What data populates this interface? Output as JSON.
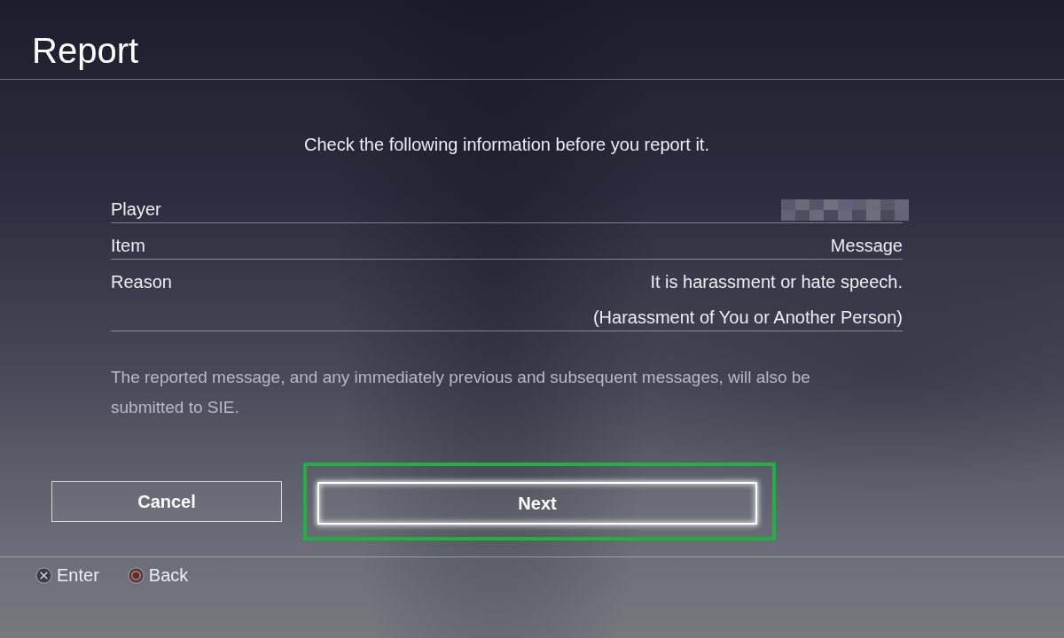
{
  "screen": {
    "title": "Report"
  },
  "instruction": "Check the following information before you report it.",
  "details": [
    {
      "label": "Player",
      "kind": "redacted"
    },
    {
      "label": "Item",
      "kind": "text",
      "values": [
        "Message"
      ]
    },
    {
      "label": "Reason",
      "kind": "text",
      "values": [
        "It is harassment or hate speech.",
        "(Harassment of You or Another Person)"
      ]
    }
  ],
  "note": "The reported message, and any immediately previous and subsequent messages, will also be submitted to SIE.",
  "buttons": [
    {
      "label": "Cancel",
      "selected": false,
      "highlighted": false
    },
    {
      "label": "Next",
      "selected": true,
      "highlighted": true
    }
  ],
  "footer_hints": [
    {
      "label": "Enter",
      "kind": "cross"
    },
    {
      "label": "Back",
      "kind": "circle"
    }
  ]
}
